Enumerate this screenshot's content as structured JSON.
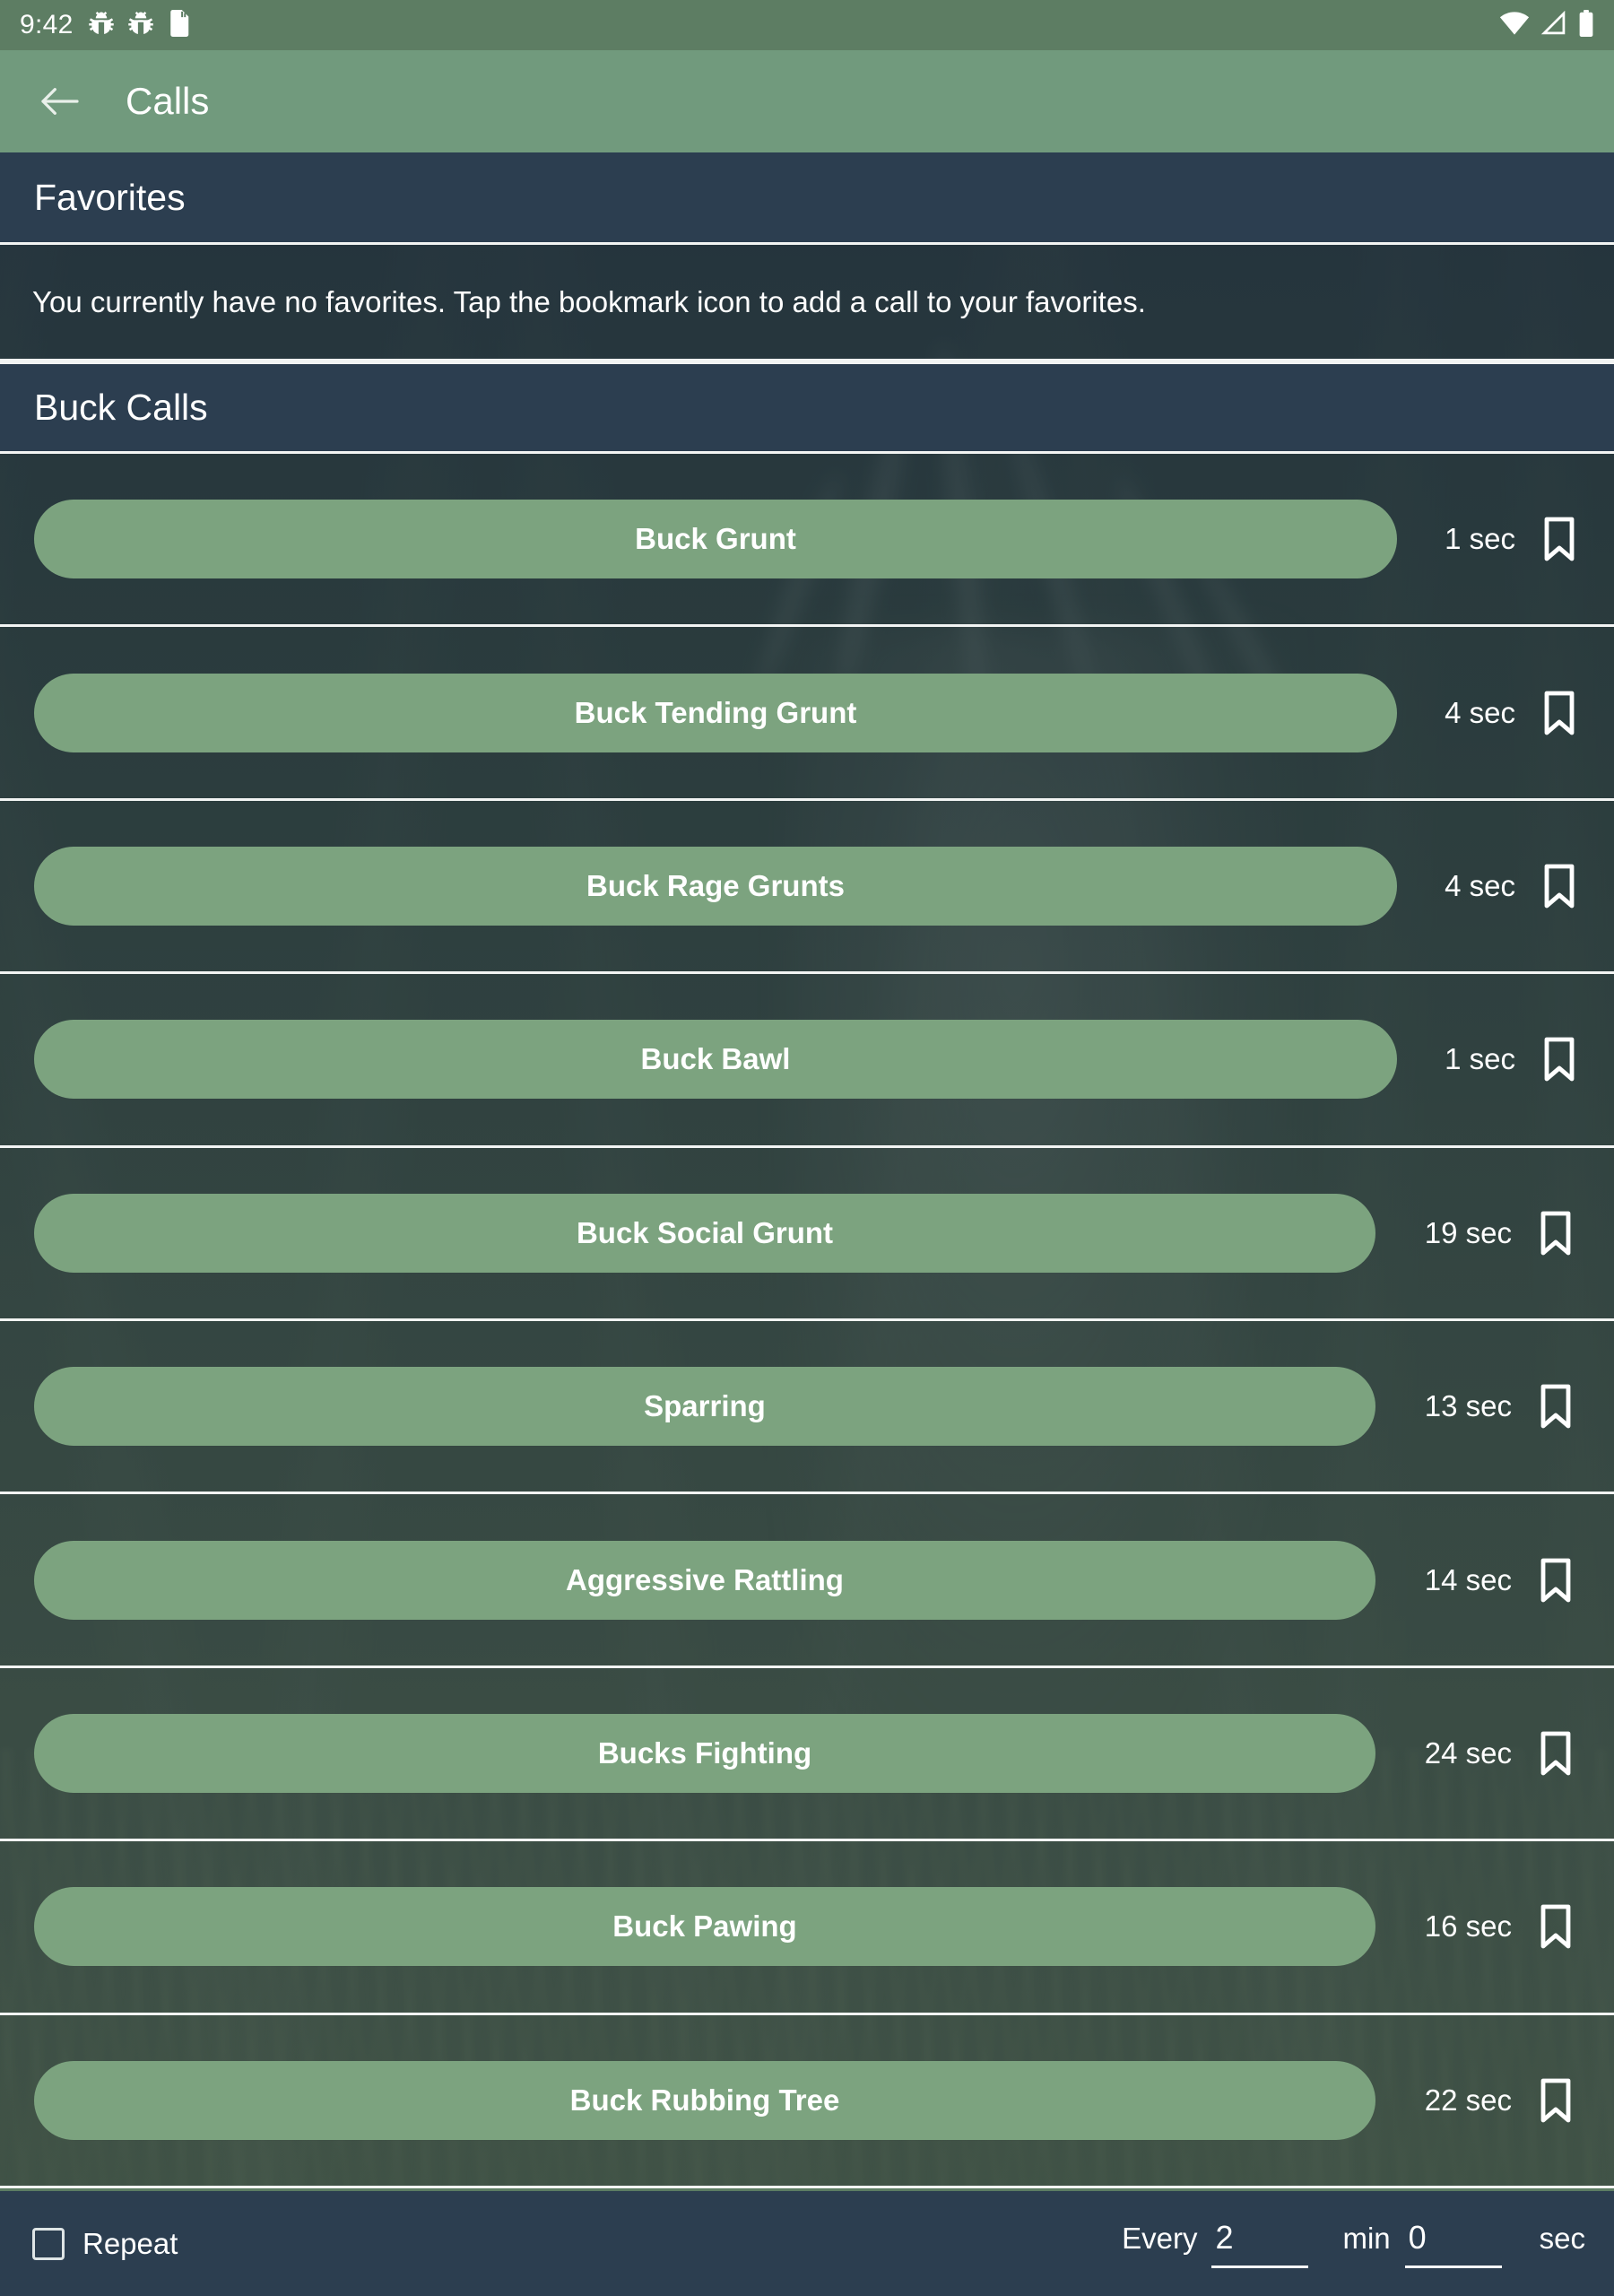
{
  "status_bar": {
    "time": "9:42",
    "left_icons": [
      "bug-icon",
      "bug-icon",
      "sd-card-icon"
    ],
    "right_icons": [
      "wifi-icon",
      "cell-signal-icon",
      "battery-icon"
    ],
    "background_color": "#5d7d63"
  },
  "app_bar": {
    "back_label": "back-arrow-icon",
    "title": "Calls",
    "background_color": "#719a7d"
  },
  "favorites": {
    "header": "Favorites",
    "empty_message": "You currently have no favorites. Tap the bookmark icon to add a call to your favorites."
  },
  "buck_calls": {
    "header": "Buck Calls",
    "rows": [
      {
        "name": "Buck Grunt",
        "duration": "1 sec",
        "bookmarked": false
      },
      {
        "name": "Buck Tending Grunt",
        "duration": "4 sec",
        "bookmarked": false
      },
      {
        "name": "Buck Rage Grunts",
        "duration": "4 sec",
        "bookmarked": false
      },
      {
        "name": "Buck Bawl",
        "duration": "1 sec",
        "bookmarked": false
      },
      {
        "name": "Buck Social Grunt",
        "duration": "19 sec",
        "bookmarked": false
      },
      {
        "name": "Sparring",
        "duration": "13 sec",
        "bookmarked": false
      },
      {
        "name": "Aggressive Rattling",
        "duration": "14 sec",
        "bookmarked": false
      },
      {
        "name": "Bucks Fighting",
        "duration": "24 sec",
        "bookmarked": false
      },
      {
        "name": "Buck Pawing",
        "duration": "16 sec",
        "bookmarked": false
      },
      {
        "name": "Buck Rubbing Tree",
        "duration": "22 sec",
        "bookmarked": false
      }
    ]
  },
  "bottom_bar": {
    "repeat_label": "Repeat",
    "repeat_checked": false,
    "every_label": "Every",
    "minutes_value": "2",
    "min_label": "min",
    "seconds_value": "0",
    "sec_label": "sec",
    "background_color": "#2c3e50"
  },
  "theme": {
    "accent_green": "#7ca37f",
    "appbar_green": "#719a7d",
    "statusbar_green": "#5d7d63",
    "header_navy": "#2c3e50",
    "divider": "#f2f4f3",
    "text_on_dark": "#ffffff"
  }
}
